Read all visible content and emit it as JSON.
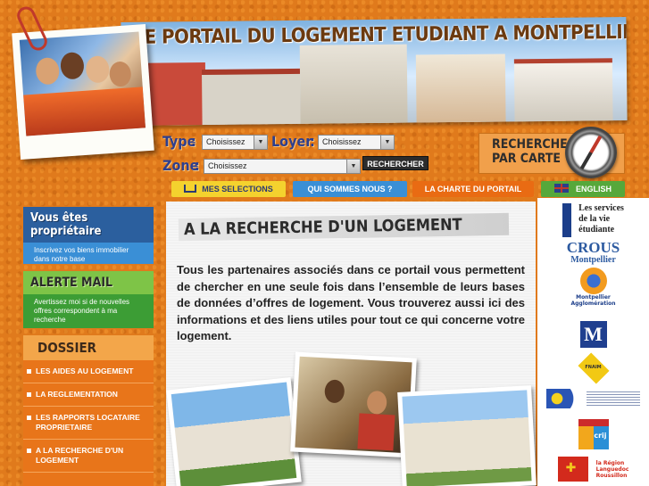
{
  "header": {
    "title": "LE PORTAIL DU LOGEMENT ETUDIANT A MONTPELLIER"
  },
  "search": {
    "type_label": "Type",
    "loyer_label": "Loyer",
    "zone_label": "Zone",
    "type_value": "Choisissez",
    "loyer_value": "Choisissez",
    "zone_value": "Choisissez",
    "search_button": "RECHERCHER",
    "map_search": "RECHERCHE PAR CARTE"
  },
  "nav": {
    "selections": "MES SELECTIONS",
    "about": "QUI SOMMES NOUS ?",
    "charter": "LA CHARTE DU PORTAIL",
    "english": "ENGLISH"
  },
  "sidebar": {
    "owner_title": "Vous êtes propriétaire",
    "owner_text": "Inscrivez vos biens immobilier dans notre base",
    "alert_title": "ALERTE MAIL",
    "alert_text": "Avertissez moi si de nouvelles offres correspondent à ma recherche",
    "dossier_title": "DOSSIER",
    "dossier_items": [
      {
        "label": "LES AIDES AU LOGEMENT"
      },
      {
        "label": "LA REGLEMENTATION"
      },
      {
        "label": "LES RAPPORTS LOCATAIRE PROPRIETAIRE"
      },
      {
        "label": "A LA RECHERCHE D'UN LOGEMENT"
      }
    ]
  },
  "main": {
    "title": "A LA RECHERCHE D'UN LOGEMENT",
    "intro": "Tous les partenaires associés dans ce portail vous permettent de chercher en une seule fois dans l’ensemble de leurs bases de données d’offres de logement. Vous trouverez aussi ici des informations et des liens utiles pour tout ce qui concerne votre logement."
  },
  "partners": {
    "services_line1": "Les services",
    "services_line2": "de la vie",
    "services_line3": "étudiante",
    "crous": "CROUS",
    "crous_city": "Montpellier",
    "agglo_line1": "Montpellier",
    "agglo_line2": "Agglomération",
    "fnaim": "FNAIM",
    "crij": "crij",
    "region_line1": "la Région",
    "region_line2": "Languedoc",
    "region_line3": "Roussillon"
  },
  "colors": {
    "background": "#e07a1c",
    "tab_yellow": "#f4d22e",
    "tab_blue": "#3a8fd6",
    "tab_orange": "#e96b13",
    "tab_green": "#56a83b"
  }
}
